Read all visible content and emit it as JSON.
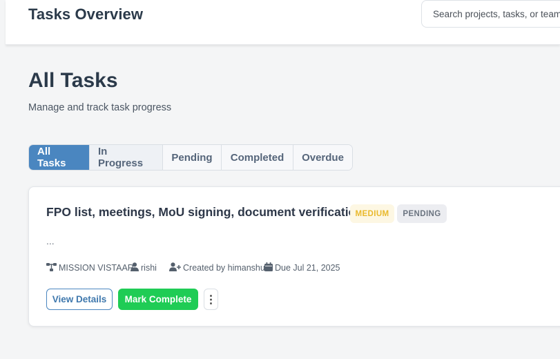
{
  "header": {
    "title": "Tasks Overview",
    "search_placeholder": "Search projects, tasks, or team members..."
  },
  "page": {
    "title": "All Tasks",
    "subtitle": "Manage and track task progress"
  },
  "tabs": [
    {
      "label": "All Tasks",
      "active": true
    },
    {
      "label": "In Progress",
      "active": false
    },
    {
      "label": "Pending",
      "active": false
    },
    {
      "label": "Completed",
      "active": false
    },
    {
      "label": "Overdue",
      "active": false
    }
  ],
  "task": {
    "title": "FPO list, meetings, MoU signing, document verification",
    "priority": "MEDIUM",
    "status": "PENDING",
    "description": "...",
    "project": "MISSION VISTAAR",
    "assignee": "rishi",
    "created_by": "Created by himanshu",
    "due": "Due Jul 21, 2025",
    "view_label": "View Details",
    "complete_label": "Mark Complete",
    "more_label": "⋮"
  },
  "colors": {
    "accent": "#4a86c0",
    "success": "#1fcc55",
    "priority_medium": "#e9b92c",
    "status_pending": "#6b7480"
  },
  "icons": {
    "project": "sitemap-icon",
    "assignee": "user-icon",
    "creator": "user-plus-icon",
    "due": "calendar-icon",
    "more": "vertical-ellipsis-icon"
  }
}
